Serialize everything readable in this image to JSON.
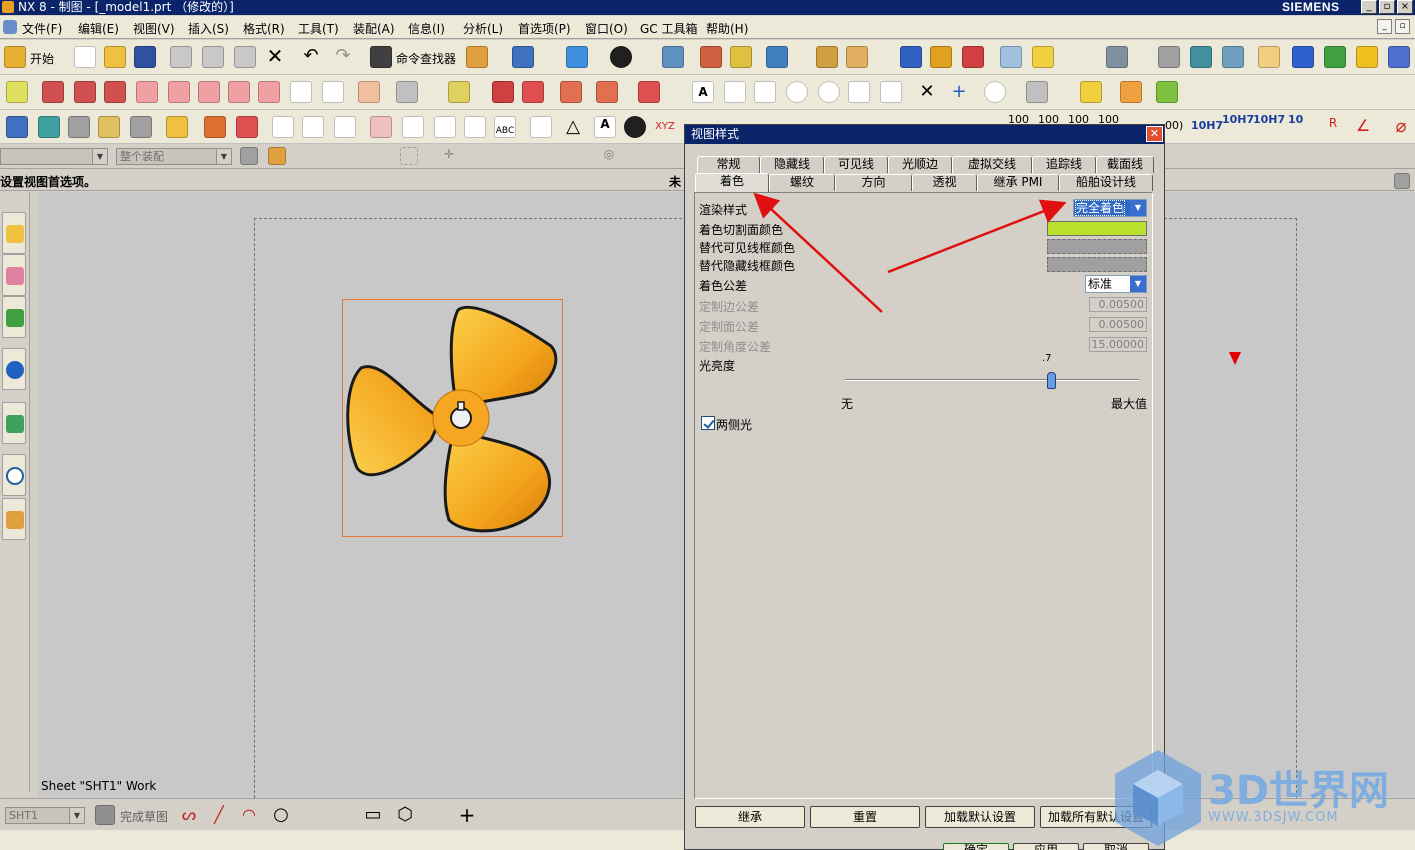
{
  "window": {
    "title": "NX 8 - 制图 - [_model1.prt （修改的）]",
    "brand": "SIEMENS"
  },
  "menu": [
    "文件(F)",
    "编辑(E)",
    "视图(V)",
    "插入(S)",
    "格式(R)",
    "工具(T)",
    "装配(A)",
    "信息(I)",
    "分析(L)",
    "首选项(P)",
    "窗口(O)",
    "GC 工具箱",
    "帮助(H)"
  ],
  "toolbar": {
    "start_label": "开始",
    "command_finder_label": "命令查找器",
    "tolerance_labels": [
      "10H7",
      "10H7",
      "10H7",
      "10"
    ],
    "dim_labels": [
      "100",
      "100",
      "100",
      "100"
    ],
    "dim_end_label": "00)"
  },
  "selection_bar": {
    "filter_combo": "",
    "assembly_combo": "整个装配"
  },
  "cue_line": {
    "left": "设置视图首选项。",
    "right": "未"
  },
  "canvas": {
    "sheet_label": "Sheet \"SHT1\" Work"
  },
  "status_bar": {
    "sheet_combo": "SHT1",
    "finish_sketch": "完成草图"
  },
  "dialog": {
    "title": "视图样式",
    "tabs_row1": [
      "常规",
      "隐藏线",
      "可见线",
      "光顺边",
      "虚拟交线",
      "追踪线",
      "截面线"
    ],
    "tabs_row2": [
      "着色",
      "螺纹",
      "方向",
      "透视",
      "继承 PMI",
      "船舶设计线"
    ],
    "active_tab": "着色",
    "render_style_label": "渲染样式",
    "render_style_value": "完全着色",
    "section_color_label": "着色切割面颜色",
    "alt_visible_color_label": "替代可见线框颜色",
    "alt_hidden_color_label": "替代隐藏线框颜色",
    "shading_tolerance_label": "着色公差",
    "shading_tolerance_value": "标准",
    "custom_edge_tol_label": "定制边公差",
    "custom_edge_tol_value": "0.00500",
    "custom_face_tol_label": "定制面公差",
    "custom_face_tol_value": "0.00500",
    "custom_angle_tol_label": "定制角度公差",
    "custom_angle_tol_value": "15.00000",
    "brightness_label": "光亮度",
    "brightness_value": ".7",
    "brightness_level": 0.7,
    "slider_min_label": "无",
    "slider_max_label": "最大值",
    "two_sided_label": "两侧光",
    "two_sided_checked": true,
    "buttons": [
      "继承",
      "重置",
      "加载默认设置",
      "加载所有默认设置"
    ],
    "bottom_buttons": [
      "确定",
      "应用",
      "取消"
    ],
    "colors": {
      "section_color": "#b8e02c",
      "title_bar": "#0a246a"
    }
  },
  "watermark": {
    "text": "3D世界网",
    "url": "WWW.3DSJW.COM"
  }
}
